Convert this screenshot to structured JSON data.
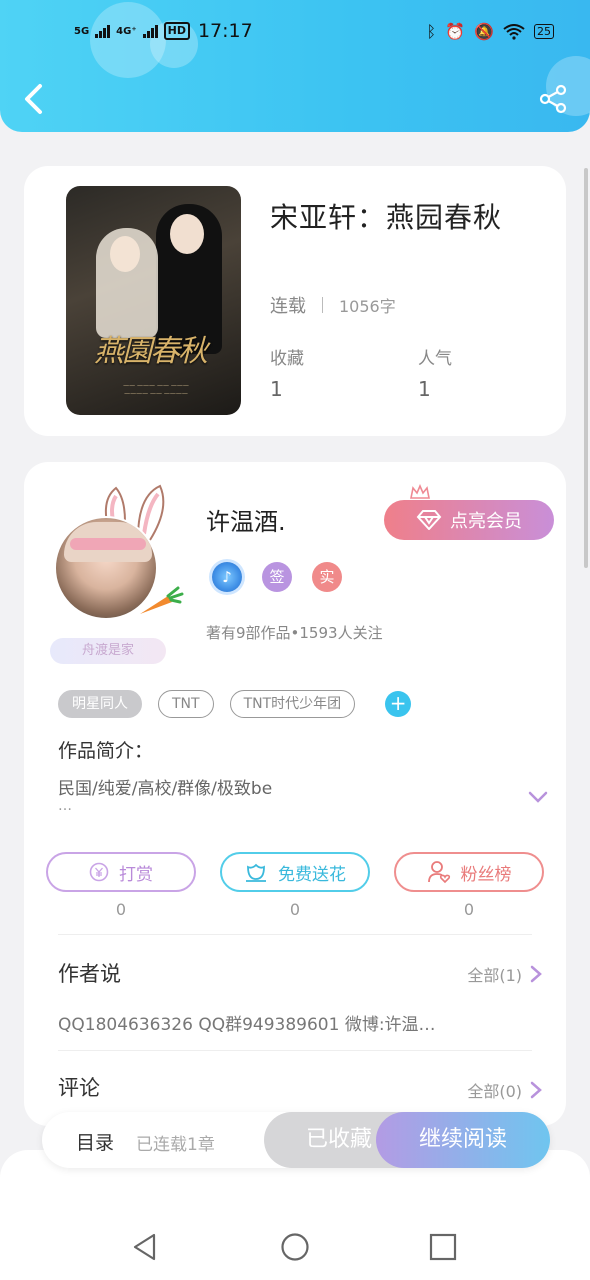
{
  "status_bar": {
    "signal_1": "5G",
    "signal_2": "4G⁺",
    "hd": "HD",
    "time": "17:17",
    "battery": "25"
  },
  "header": {
    "back_icon": "chevron-left-icon",
    "share_icon": "share-icon"
  },
  "book": {
    "title": "宋亚轩：燕园春秋",
    "status": "连载",
    "word_count": "1056字",
    "stats": [
      {
        "label": "收藏",
        "value": "1"
      },
      {
        "label": "人气",
        "value": "1"
      }
    ]
  },
  "author": {
    "name": "许温酒.",
    "vip_button": "点亮会员",
    "badges": [
      {
        "icon": "music-medal-icon",
        "text": ""
      },
      {
        "icon": "sign-badge-icon",
        "text": "签"
      },
      {
        "icon": "real-badge-icon",
        "text": "实"
      }
    ],
    "home_badge": "舟渡是家",
    "works_info": "著有9部作品•1593人关注",
    "tags": [
      "明星同人",
      "TNT",
      "TNT时代少年团"
    ],
    "intro_label": "作品简介：",
    "intro_text": "民国/纯爱/高校/群像/极致be",
    "intro_more": "…",
    "actions": [
      {
        "label": "打赏",
        "count": "0",
        "icon": "yen-icon"
      },
      {
        "label": "免费送花",
        "count": "0",
        "icon": "flower-icon"
      },
      {
        "label": "粉丝榜",
        "count": "0",
        "icon": "fan-ranking-icon"
      }
    ],
    "author_says_title": "作者说",
    "author_says_all": "全部(1)",
    "author_says_text": "QQ1804636326 QQ群949389601 微博:许温…",
    "comments_title": "评论",
    "comments_all": "全部(0)"
  },
  "bottom_bar": {
    "toc_label": "目录",
    "toc_sub": "已连载1章",
    "collected_label": "已收藏",
    "continue_label": "继续阅读"
  },
  "colors": {
    "header_start": "#4fd3f5",
    "header_end": "#39b8f0",
    "vip_start": "#ef7f8a",
    "vip_end": "#c98fd8",
    "continue_start": "#b39be4",
    "continue_end": "#6fc5ef"
  }
}
